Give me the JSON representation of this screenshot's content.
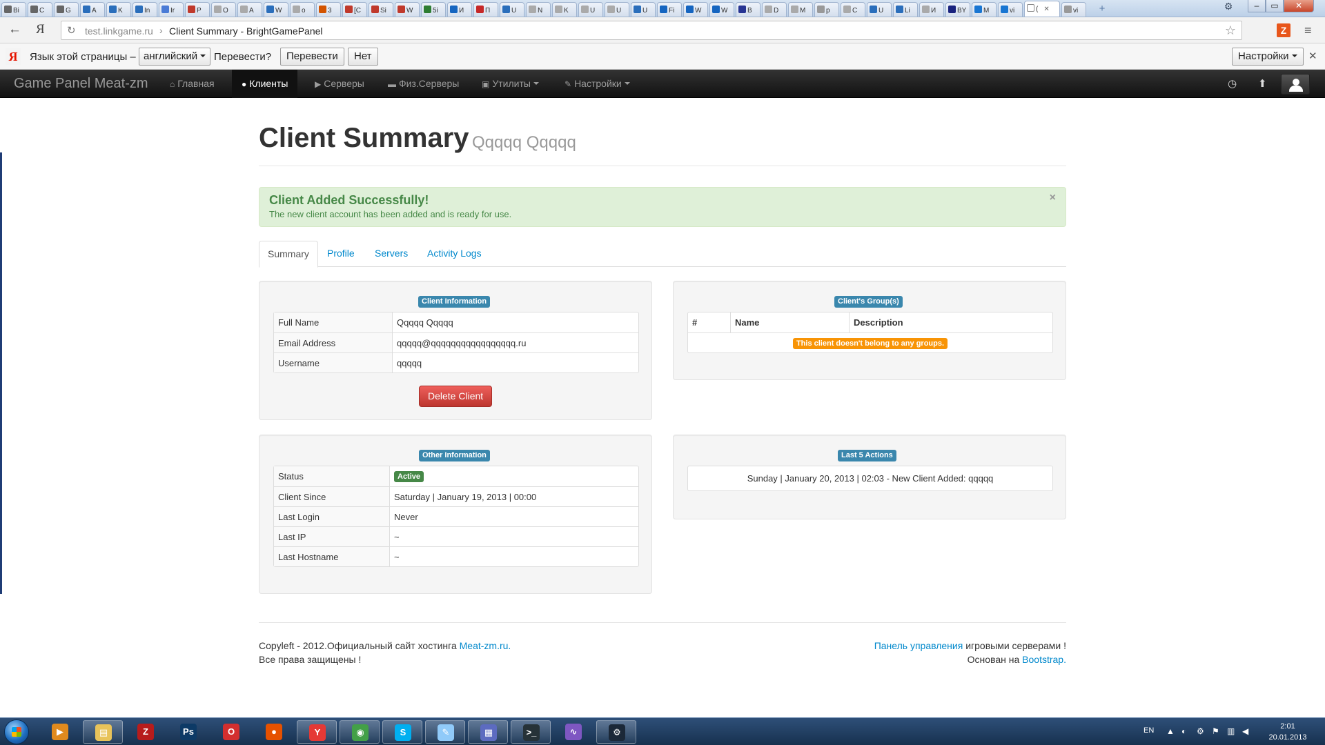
{
  "browser": {
    "tabs": [
      {
        "label": "Bi",
        "color": "#666666"
      },
      {
        "label": "C",
        "color": "#666666"
      },
      {
        "label": "G",
        "color": "#666666"
      },
      {
        "label": "A",
        "color": "#2a6ebb"
      },
      {
        "label": "K",
        "color": "#2a6ebb"
      },
      {
        "label": "In",
        "color": "#2a6ebb"
      },
      {
        "label": "Ir",
        "color": "#4a7bd6"
      },
      {
        "label": "P",
        "color": "#c0392b"
      },
      {
        "label": "O",
        "color": "#aaaaaa"
      },
      {
        "label": "A",
        "color": "#aaaaaa"
      },
      {
        "label": "W",
        "color": "#2a6ebb"
      },
      {
        "label": "o",
        "color": "#aaaaaa"
      },
      {
        "label": "3",
        "color": "#d35400"
      },
      {
        "label": "[C",
        "color": "#c0392b"
      },
      {
        "label": "Si",
        "color": "#c0392b"
      },
      {
        "label": "W",
        "color": "#c0392b"
      },
      {
        "label": "5i",
        "color": "#2e7d32"
      },
      {
        "label": "И",
        "color": "#1565c0"
      },
      {
        "label": "П",
        "color": "#c62828"
      },
      {
        "label": "U",
        "color": "#2a6ebb"
      },
      {
        "label": "N",
        "color": "#aaaaaa"
      },
      {
        "label": "K",
        "color": "#aaaaaa"
      },
      {
        "label": "U",
        "color": "#aaaaaa"
      },
      {
        "label": "U",
        "color": "#aaaaaa"
      },
      {
        "label": "U",
        "color": "#2a6ebb"
      },
      {
        "label": "Fi",
        "color": "#1565c0"
      },
      {
        "label": "W",
        "color": "#1565c0"
      },
      {
        "label": "W",
        "color": "#1565c0"
      },
      {
        "label": "B",
        "color": "#283593"
      },
      {
        "label": "D",
        "color": "#aaaaaa"
      },
      {
        "label": "M",
        "color": "#aaaaaa"
      },
      {
        "label": "p",
        "color": "#999999"
      },
      {
        "label": "C",
        "color": "#aaaaaa"
      },
      {
        "label": "U",
        "color": "#2a6ebb"
      },
      {
        "label": "Li",
        "color": "#2a6ebb"
      },
      {
        "label": "И",
        "color": "#aaaaaa"
      },
      {
        "label": "BY",
        "color": "#1a237e"
      },
      {
        "label": "M",
        "color": "#1976d2"
      },
      {
        "label": "vi",
        "color": "#1976d2"
      },
      {
        "label": "(",
        "color": "#ffffff",
        "active": true
      },
      {
        "label": "vi",
        "color": "#999999"
      }
    ],
    "active_tab_close": "✕",
    "url_domain": "test.linkgame.ru",
    "url_sep": "›",
    "page_title": "Client Summary - BrightGamePanel",
    "ext_letter": "Z"
  },
  "translate_bar": {
    "prompt": "Язык этой страницы –",
    "language": "английский",
    "question": "Перевести?",
    "translate_button": "Перевести",
    "no_button": "Нет",
    "settings": "Настройки",
    "close": "✕"
  },
  "navbar": {
    "brand": "Game Panel Meat-zm",
    "items": [
      {
        "label": "Главная",
        "icon": "home-icon"
      },
      {
        "label": "Клиенты",
        "icon": "user-icon",
        "active": true
      },
      {
        "label": "Серверы",
        "icon": "play-icon"
      },
      {
        "label": "Физ.Серверы",
        "icon": "hdd-icon"
      },
      {
        "label": "Утилиты",
        "icon": "briefcase-icon",
        "dropdown": true
      },
      {
        "label": "Настройки",
        "icon": "wrench-icon",
        "dropdown": true
      }
    ]
  },
  "page": {
    "title": "Client Summary",
    "subtitle": "Qqqqq Qqqqq",
    "alert_title": "Client Added Successfully!",
    "alert_text": "The new client account has been added and is ready for use.",
    "alert_close": "×",
    "tabs": [
      "Summary",
      "Profile",
      "Servers",
      "Activity Logs"
    ]
  },
  "client_info": {
    "heading": "Client Information",
    "rows": [
      {
        "key": "Full Name",
        "value": "Qqqqq Qqqqq"
      },
      {
        "key": "Email Address",
        "value": "qqqqq@qqqqqqqqqqqqqqqqq.ru"
      },
      {
        "key": "Username",
        "value": "qqqqq"
      }
    ],
    "delete_button": "Delete Client"
  },
  "groups": {
    "heading": "Client's Group(s)",
    "columns": [
      "#",
      "Name",
      "Description"
    ],
    "empty_text": "This client doesn't belong to any groups."
  },
  "other_info": {
    "heading": "Other Information",
    "status_key": "Status",
    "status_value": "Active",
    "rows": [
      {
        "key": "Client Since",
        "value": "Saturday | January 19, 2013 | 00:00"
      },
      {
        "key": "Last Login",
        "value": "Never"
      },
      {
        "key": "Last IP",
        "value": "~"
      },
      {
        "key": "Last Hostname",
        "value": "~"
      }
    ]
  },
  "actions": {
    "heading": "Last 5 Actions",
    "items": [
      "Sunday | January 20, 2013 | 02:03 - New Client Added: qqqqq"
    ]
  },
  "footer": {
    "left_line1": "Copyleft - 2012.Официальный сайт хостинга ",
    "left_link": "Meat-zm.ru.",
    "left_line2": "Все права защищены !",
    "right_link1": "Панель управления",
    "right_text1": " игровыми серверами !",
    "right_text2": "Основан на ",
    "right_link2": "Bootstrap."
  },
  "taskbar": {
    "apps": [
      {
        "name": "media-player-icon",
        "color": "#e08a1e",
        "glyph": "▶"
      },
      {
        "name": "explorer-icon",
        "color": "#e8c35a",
        "glyph": "▤",
        "pinned": true
      },
      {
        "name": "filezilla-icon",
        "color": "#b71c1c",
        "glyph": "Z"
      },
      {
        "name": "photoshop-icon",
        "color": "#0d3a66",
        "glyph": "Ps"
      },
      {
        "name": "opera-icon",
        "color": "#d32f2f",
        "glyph": "O"
      },
      {
        "name": "firefox-icon",
        "color": "#e65100",
        "glyph": "●"
      },
      {
        "name": "yandex-browser-icon",
        "color": "#e53935",
        "glyph": "Y",
        "pinned": true
      },
      {
        "name": "chrome-icon",
        "color": "#43a047",
        "glyph": "◉",
        "pinned": true
      },
      {
        "name": "skype-icon",
        "color": "#00aff0",
        "glyph": "S",
        "pinned": true
      },
      {
        "name": "notepad-icon",
        "color": "#90caf9",
        "glyph": "✎",
        "pinned": true
      },
      {
        "name": "network-icon",
        "color": "#5c6bc0",
        "glyph": "▦",
        "pinned": true
      },
      {
        "name": "terminal-icon",
        "color": "#263238",
        "glyph": ">_",
        "pinned": true
      },
      {
        "name": "app-icon",
        "color": "#7e57c2",
        "glyph": "∿"
      },
      {
        "name": "steam-icon",
        "color": "#1b2838",
        "glyph": "⚙",
        "pinned": true
      }
    ],
    "lang": "EN",
    "time": "2:01",
    "date": "20.01.2013"
  }
}
